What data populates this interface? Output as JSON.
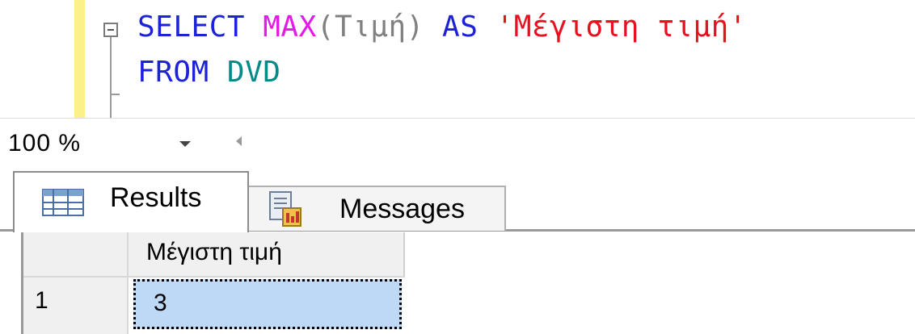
{
  "editor": {
    "line1": {
      "select_kw": "SELECT",
      "max_fn": "MAX",
      "open_paren": "(",
      "column": "Τιμή",
      "close_paren": ")",
      "as_kw": "AS",
      "alias": "'Μέγιστη τιμή'"
    },
    "line2": {
      "from_kw": "FROM",
      "table": "DVD"
    }
  },
  "zoom": {
    "value": "100 %"
  },
  "tabs": [
    {
      "label": "Results",
      "icon": "grid-icon",
      "selected": true
    },
    {
      "label": "Messages",
      "icon": "messages-icon",
      "selected": false
    }
  ],
  "results": {
    "columns": [
      "Μέγιστη τιμή"
    ],
    "rows": [
      {
        "row_number": "1",
        "values": [
          "3"
        ]
      }
    ]
  },
  "colors": {
    "keyword": "#1b22d8",
    "function": "#e61ae8",
    "string": "#e8101e",
    "table": "#008a8a",
    "change_bar": "#fbf089",
    "selected_cell": "#bdd9f5"
  }
}
